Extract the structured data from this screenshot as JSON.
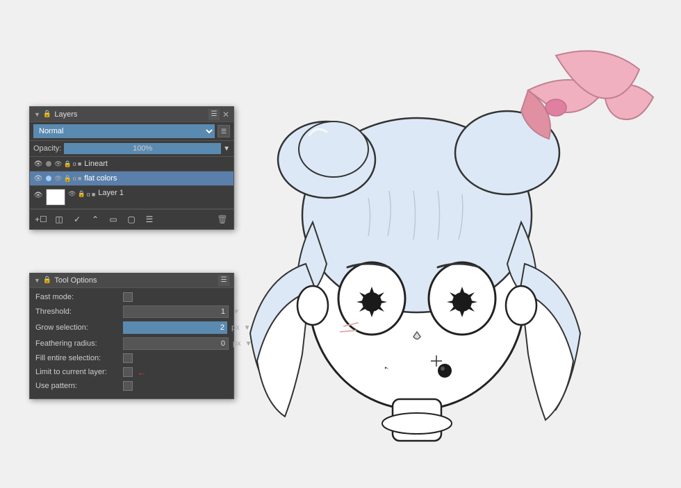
{
  "canvas": {
    "background": "#f0f0f0"
  },
  "layers_panel": {
    "title": "Layers",
    "blend_mode": "Normal",
    "opacity_label": "Opacity:",
    "opacity_value": "100%",
    "layers": [
      {
        "name": "Lineart",
        "visible": true,
        "selected": false,
        "has_thumb": false
      },
      {
        "name": "flat colors",
        "visible": true,
        "selected": true,
        "has_thumb": false
      },
      {
        "name": "Layer 1",
        "visible": true,
        "selected": false,
        "has_thumb": true
      }
    ],
    "toolbar_buttons": [
      "+",
      "group",
      "v",
      "^",
      "duplicate",
      "anchor",
      "equalizer",
      "delete"
    ]
  },
  "tool_options_panel": {
    "title": "Tool Options",
    "options": [
      {
        "label": "Fast mode:",
        "type": "checkbox",
        "value": false
      },
      {
        "label": "Threshold:",
        "type": "number",
        "value": "1"
      },
      {
        "label": "Grow selection:",
        "type": "number_blue",
        "value": "2",
        "unit": "px"
      },
      {
        "label": "Feathering radius:",
        "type": "number_plain",
        "value": "0",
        "unit": "px"
      },
      {
        "label": "Fill entire selection:",
        "type": "checkbox",
        "value": false
      },
      {
        "label": "Limit to current layer:",
        "type": "checkbox_arrow",
        "value": false
      },
      {
        "label": "Use pattern:",
        "type": "checkbox",
        "value": false
      }
    ]
  }
}
